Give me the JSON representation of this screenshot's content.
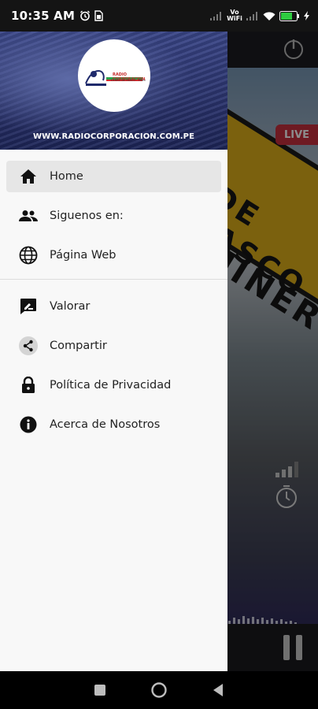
{
  "status_bar": {
    "time": "10:35 AM",
    "network_label": "Vo WiFi",
    "battery_level": "64",
    "icons": [
      "alarm-icon",
      "sim-icon",
      "signal-icon",
      "vowifi-icon",
      "signal-icon",
      "wifi-icon",
      "battery-icon",
      "charging-icon"
    ]
  },
  "drawer": {
    "header": {
      "logo_text_top": "RADIO CORPORACION",
      "logo_text_bottom": "CERRO DE PASCO - PERU",
      "url": "WWW.RADIOCORPORACION.COM.PE"
    },
    "primary_items": [
      {
        "label": "Home",
        "icon": "home-icon",
        "active": true
      },
      {
        "label": "Siguenos en:",
        "icon": "people-icon",
        "active": false
      },
      {
        "label": "Página Web",
        "icon": "globe-icon",
        "active": false
      }
    ],
    "secondary_items": [
      {
        "label": "Valorar",
        "icon": "rate-review-icon"
      },
      {
        "label": "Compartir",
        "icon": "share-icon"
      },
      {
        "label": "Política de Privacidad",
        "icon": "lock-icon"
      },
      {
        "label": "Acerca de Nosotros",
        "icon": "info-icon"
      }
    ]
  },
  "background_app": {
    "live_badge": "LIVE",
    "sign_text_1": "DE PASCO",
    "sign_text_2": "MINER",
    "icons": [
      "power-icon",
      "pause-icon",
      "timer-icon",
      "signal-bars-icon"
    ]
  },
  "nav_bar": {
    "icons": [
      "recents-icon",
      "home-circle-icon",
      "back-icon"
    ]
  },
  "colors": {
    "drawer_bg": "#f8f8f8",
    "active_item_bg": "#e6e6e6",
    "header_blue": "#2c356f",
    "live_red": "#c8303f",
    "sign_yellow": "#e0b11a"
  }
}
